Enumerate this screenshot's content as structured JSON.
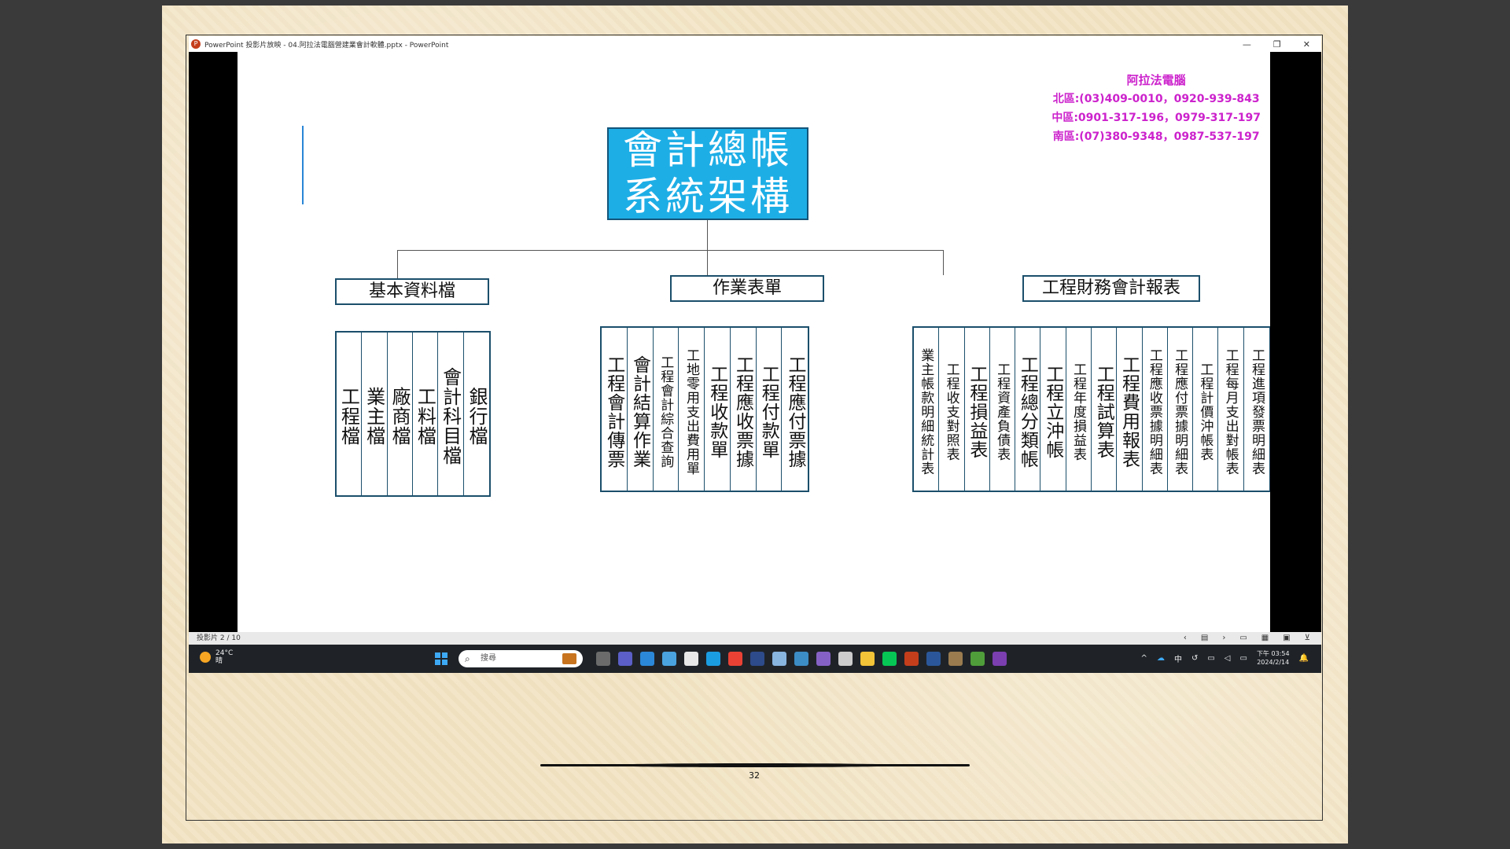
{
  "window": {
    "title": "PowerPoint 投影片放映  -  04.阿拉法電腦營建業會計軟體.pptx - PowerPoint",
    "controls": {
      "minimize": "—",
      "restore": "❐",
      "close": "✕"
    }
  },
  "slide": {
    "contact": {
      "name": "阿拉法電腦",
      "north": "北區:(03)409-0010，0920-939-843",
      "central": "中區:0901-317-196，0979-317-197",
      "south": "南區:(07)380-9348，0987-537-197"
    },
    "root": {
      "line1": "會計總帳",
      "line2": "系統架構"
    },
    "categories": {
      "basic": "基本資料檔",
      "forms": "作業表單",
      "reports": "工程財務會計報表"
    },
    "basic_items": [
      "工程檔",
      "業主檔",
      "廠商檔",
      "工料檔",
      "會計科目檔",
      "銀行檔"
    ],
    "form_items": [
      "工程會計傳票",
      "會計結算作業",
      "工程會計綜合查詢",
      "工地零用支出費用單",
      "工程收款單",
      "工程應收票據",
      "工程付款單",
      "工程應付票據"
    ],
    "report_items": [
      "業主帳款明細統計表",
      "工程收支對照表",
      "工程損益表",
      "工程資產負債表",
      "工程總分類帳",
      "工程立沖帳",
      "工程年度損益表",
      "工程試算表",
      "工程費用報表",
      "工程應收票據明細表",
      "工程應付票據明細表",
      "工程計價沖帳表",
      "工程每月支出對帳表",
      "工程進項發票明細表"
    ]
  },
  "status": {
    "slide_no": "投影片 2 / 10"
  },
  "taskbar": {
    "temp": "24°C",
    "weather": "晴",
    "search_placeholder": "搜尋",
    "ime": "中",
    "time": "下午 03:54",
    "date": "2024/2/14"
  },
  "page_number": "32",
  "colors": {
    "accent": "#1eaee6",
    "contact": "#cc22cc"
  }
}
